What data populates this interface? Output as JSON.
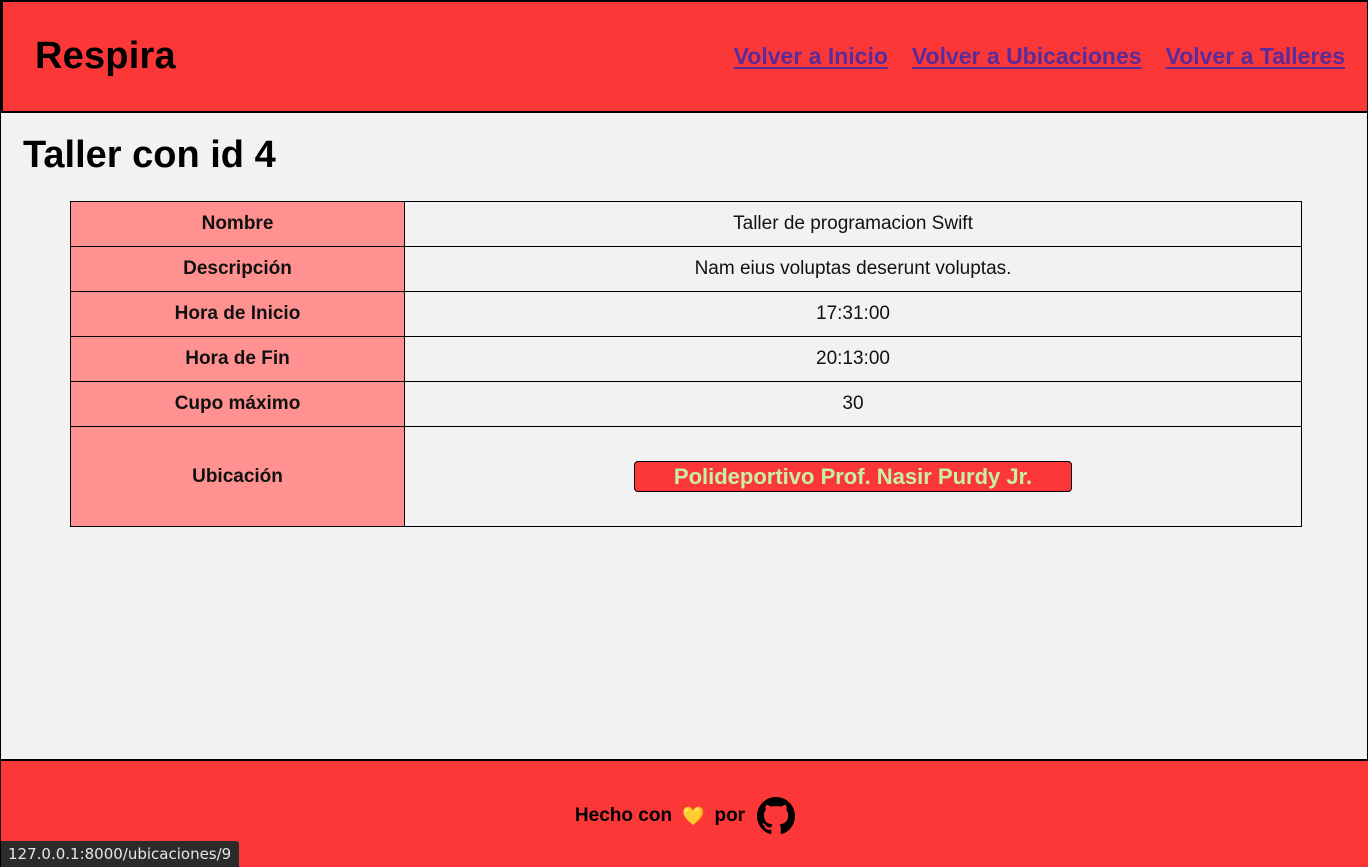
{
  "header": {
    "brand": "Respira",
    "nav": [
      {
        "label": "Volver a Inicio"
      },
      {
        "label": "Volver a Ubicaciones"
      },
      {
        "label": "Volver a Talleres"
      }
    ]
  },
  "main": {
    "title": "Taller con id 4",
    "rows": [
      {
        "label": "Nombre",
        "value": "Taller de programacion Swift"
      },
      {
        "label": "Descripción",
        "value": "Nam eius voluptas deserunt voluptas."
      },
      {
        "label": "Hora de Inicio",
        "value": "17:31:00"
      },
      {
        "label": "Hora de Fin",
        "value": "20:13:00"
      },
      {
        "label": "Cupo máximo",
        "value": "30"
      },
      {
        "label": "Ubicación",
        "value": "Polideportivo Prof. Nasir Purdy Jr."
      }
    ]
  },
  "footer": {
    "made_with": "Hecho con",
    "by": "por",
    "heart_icon": "yellow-heart-icon",
    "github_icon": "github-icon"
  },
  "status_bar": {
    "url": "127.0.0.1:8000/ubicaciones/9"
  },
  "colors": {
    "header_bg": "#fb3737",
    "label_bg": "#ff9191",
    "link": "#5a2b9b",
    "location_text": "#c6f0a8"
  }
}
